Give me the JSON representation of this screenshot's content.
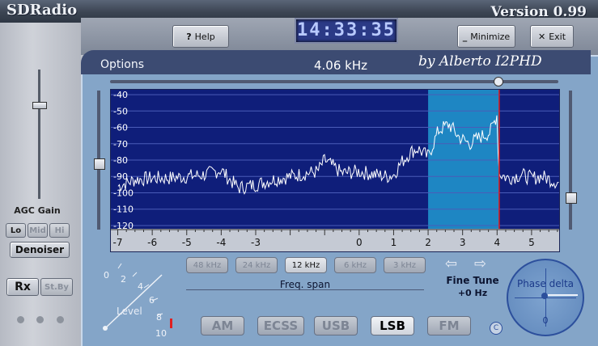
{
  "window": {
    "title": "SDRadio",
    "version": "Version 0.99",
    "author": "by Alberto I2PHD"
  },
  "header": {
    "help_label": "Help",
    "clock": "14:33:35",
    "minimize_label": "Minimize",
    "exit_label": "Exit"
  },
  "main": {
    "options_label": "Options",
    "freq_readout": "4.06 kHz",
    "freq_span_label": "Freq. span",
    "fine_tune_label": "Fine Tune",
    "fine_tune_value": "+0 Hz",
    "phase_delta_label": "Phase delta",
    "phase_delta_value": "0",
    "span_buttons": [
      "48 kHz",
      "24 kHz",
      "12 kHz",
      "6 kHz",
      "3 kHz"
    ],
    "span_selected": "12 kHz",
    "mode_buttons": [
      "AM",
      "ECSS",
      "USB",
      "LSB",
      "FM"
    ],
    "mode_selected": "LSB",
    "level_label": "Level",
    "level_scale": [
      "0",
      "2",
      "4",
      "6",
      "8",
      "10"
    ]
  },
  "left_panel": {
    "agc_label": "AGC Gain",
    "agc_buttons": [
      "Lo",
      "Mid",
      "Hi"
    ],
    "agc_selected": "Lo",
    "denoiser_label": "Denoiser",
    "rx_label": "Rx",
    "stby_label": "St.By"
  },
  "colors": {
    "spectrum_bg": "#0f1e7a",
    "passband": "#1e86c3",
    "trace": "#ffffff",
    "marker": "#e02020"
  },
  "chart_data": {
    "type": "line",
    "x_unit": "kHz",
    "xlim": [
      -7.2,
      5.8
    ],
    "ylim": [
      -122,
      -37
    ],
    "x_ticks": [
      -7,
      -6,
      -5,
      -4,
      -3,
      0,
      1,
      2,
      3,
      4,
      5
    ],
    "y_ticks": [
      -40,
      -50,
      -60,
      -70,
      -80,
      -90,
      -100,
      -110,
      -120
    ],
    "passband": [
      2.0,
      4.05
    ],
    "marker_x": 4.06,
    "grid": true,
    "series": [
      {
        "x": [
          -7.0,
          -6.5,
          -6.0,
          -5.5,
          -5.0,
          -4.5,
          -4.0,
          -3.8,
          -3.5,
          -3.0,
          -2.5,
          -2.0,
          -1.5,
          -1.2,
          -1.0,
          -0.5,
          0.0,
          0.5,
          0.8,
          1.0,
          1.2,
          1.5,
          1.7,
          2.0,
          2.3,
          2.6,
          2.9,
          3.2,
          3.5,
          3.8,
          4.0,
          4.05,
          4.3,
          4.7,
          5.0,
          5.3,
          5.8
        ],
        "y": [
          -96,
          -92,
          -91,
          -91,
          -90,
          -89,
          -86,
          -91,
          -97,
          -95,
          -92,
          -90,
          -88,
          -87,
          -80,
          -88,
          -87,
          -89,
          -90,
          -89,
          -82,
          -75,
          -73,
          -78,
          -62,
          -58,
          -66,
          -70,
          -66,
          -63,
          -52,
          -88,
          -91,
          -89,
          -91,
          -90,
          -94
        ]
      }
    ]
  }
}
